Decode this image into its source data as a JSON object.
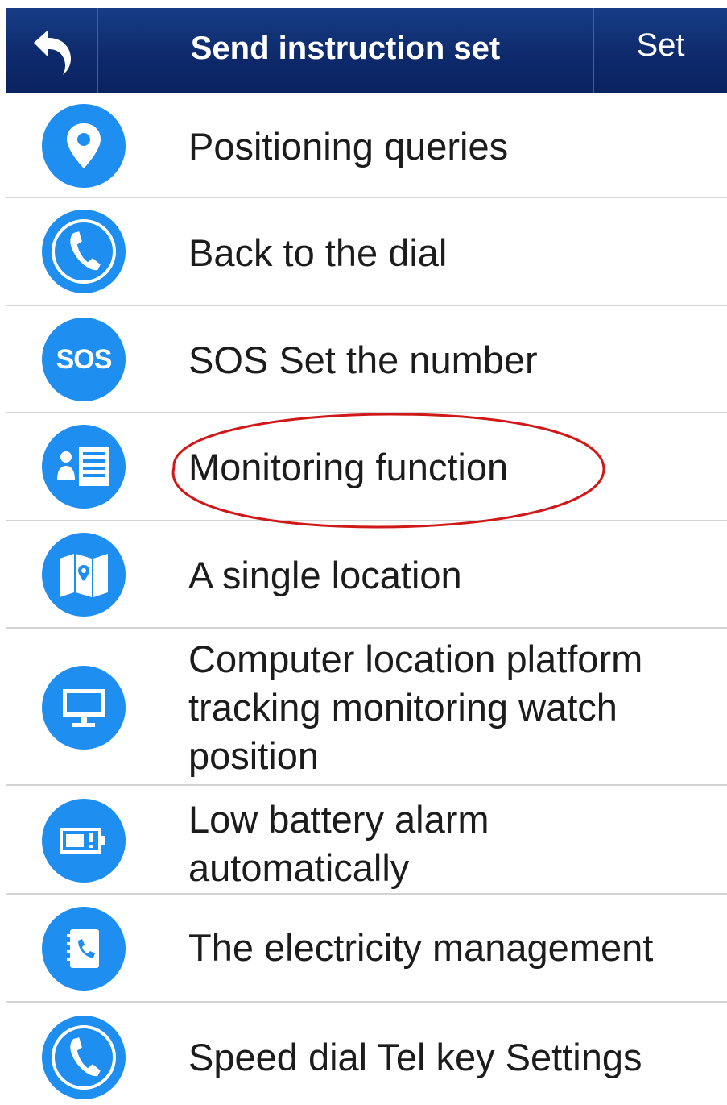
{
  "header": {
    "title": "Send instruction set",
    "set_label": "Set",
    "back_icon": "back-arrow-icon",
    "background": "#0e2a6c"
  },
  "list": {
    "items": [
      {
        "label": "Positioning queries",
        "icon": "location-pin-icon"
      },
      {
        "label": "Back to the dial",
        "icon": "phone-icon"
      },
      {
        "label": "SOS Set the number",
        "icon": "sos-icon",
        "icon_text": "SOS"
      },
      {
        "label": "Monitoring function",
        "icon": "contact-list-icon",
        "highlighted": true
      },
      {
        "label": "A single location",
        "icon": "map-icon"
      },
      {
        "label": "Computer location platform tracking monitoring watch position",
        "icon": "monitor-icon"
      },
      {
        "label": "Low battery alarm automatically",
        "icon": "battery-icon"
      },
      {
        "label": "The electricity management",
        "icon": "phone-book-icon"
      },
      {
        "label": "Speed dial Tel key Settings",
        "icon": "phone-icon"
      }
    ]
  },
  "colors": {
    "icon_background": "#1e8ef0",
    "annotation": "#d01818",
    "divider": "#d4d4d4"
  }
}
